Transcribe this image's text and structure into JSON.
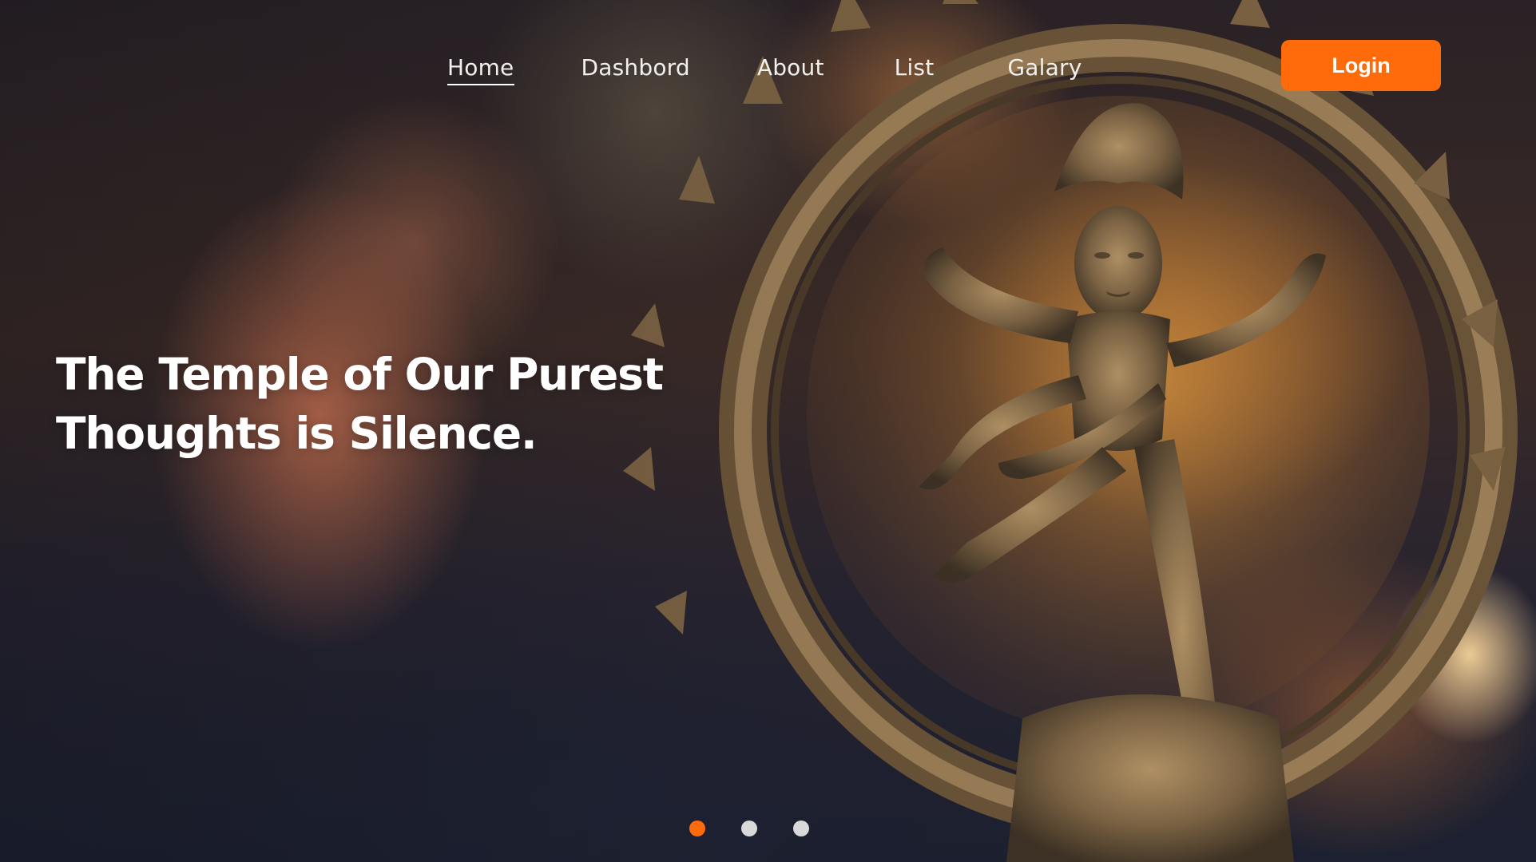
{
  "nav": {
    "items": [
      {
        "label": "Home",
        "active": true
      },
      {
        "label": "Dashbord",
        "active": false
      },
      {
        "label": "About",
        "active": false
      },
      {
        "label": "List",
        "active": false
      },
      {
        "label": "Galary",
        "active": false
      }
    ],
    "login_label": "Login"
  },
  "hero": {
    "headline_line1": "The Temple of Our Purest",
    "headline_line2": "Thoughts is Silence.",
    "image_subject": "bronze-nataraja-statue"
  },
  "carousel": {
    "slide_count": 3,
    "active_index": 0
  },
  "colors": {
    "accent": "#ff6b0a",
    "dot_inactive": "#d9d9d9",
    "text": "#ffffff"
  }
}
